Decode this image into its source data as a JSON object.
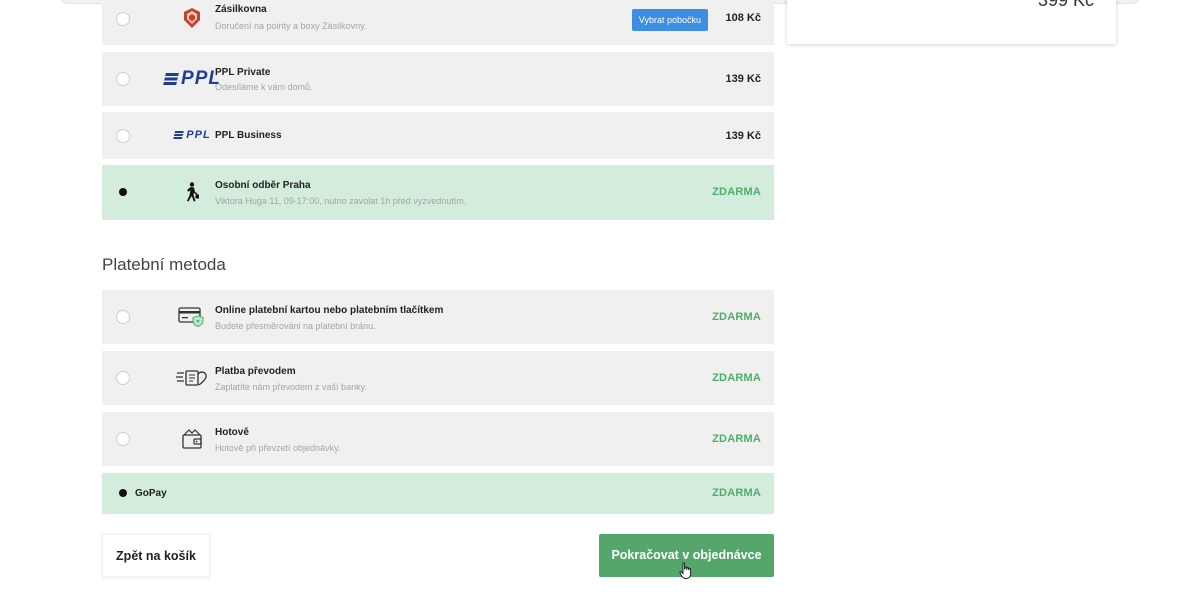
{
  "summary": {
    "price": "399 Kč"
  },
  "shipping": [
    {
      "name": "Zásilkovna",
      "desc": "Doručení na pointy a boxy Zásilkovny.",
      "button": "Vybrat pobočku",
      "price": "108 Kč",
      "selected": false,
      "icon": "zasilkovna-logo-icon"
    },
    {
      "name": "PPL Private",
      "desc": "Odesíláme k vám domů.",
      "logo_text": "PPL",
      "price": "139 Kč",
      "selected": false,
      "icon": "ppl-logo-icon"
    },
    {
      "name": "PPL Business",
      "logo_text": "PPL",
      "price": "139 Kč",
      "selected": false,
      "icon": "ppl-logo-icon"
    },
    {
      "name": "Osobní odběr Praha",
      "desc": "Viktora Huga 11, 09-17:00, nutno zavolat 1h před vyzvednutím.",
      "price": "ZDARMA",
      "selected": true,
      "icon": "walking-person-icon"
    }
  ],
  "payment_heading": "Platební metoda",
  "payment": [
    {
      "name": "Online platební kartou nebo platebním tlačítkem",
      "desc": "Budete přesměrováni na platební bránu.",
      "price": "ZDARMA",
      "selected": false,
      "icon": "credit-card-icon"
    },
    {
      "name": "Platba převodem",
      "desc": "Zaplatíte nám převodem z vaší banky.",
      "price": "ZDARMA",
      "selected": false,
      "icon": "money-transfer-icon"
    },
    {
      "name": "Hotově",
      "desc": "Hotově při převzetí objednávky.",
      "price": "ZDARMA",
      "selected": false,
      "icon": "wallet-icon"
    },
    {
      "name": "GoPay",
      "price": "ZDARMA",
      "selected": true
    }
  ],
  "actions": {
    "back": "Zpět na košík",
    "continue": "Pokračovat v objednávce"
  },
  "colors": {
    "selected_bg": "#d3ecdc",
    "row_bg": "#f0f0f0",
    "free_text": "#4caf6a",
    "primary_button": "#54a66b",
    "branch_button": "#3d8ee0"
  }
}
